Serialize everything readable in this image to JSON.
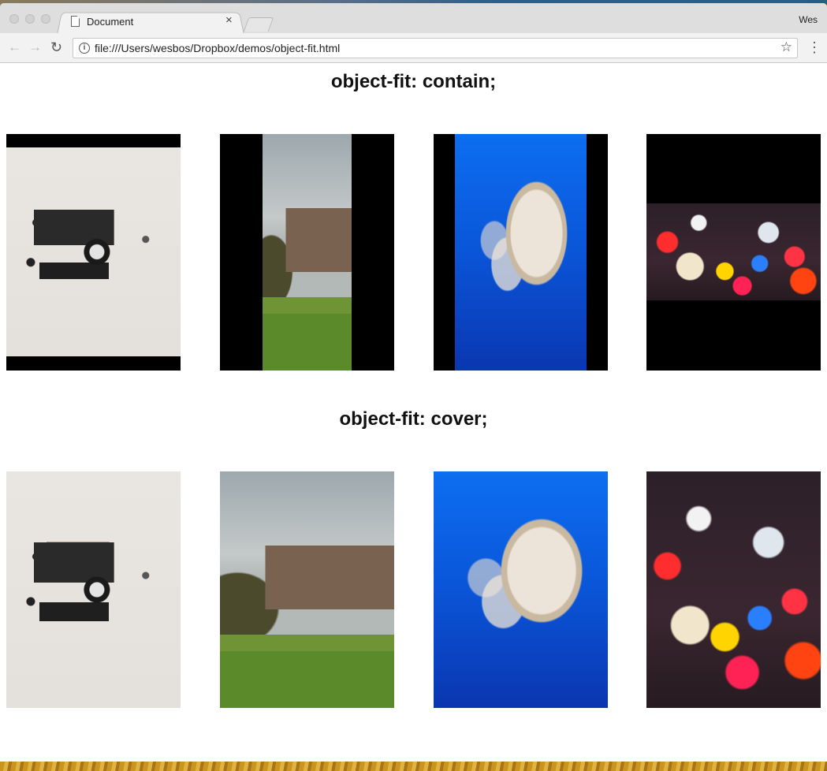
{
  "browser": {
    "tab_title": "Document",
    "tab_close": "×",
    "profile_name": "Wes",
    "url": "file:///Users/wesbos/Dropbox/demos/object-fit.html",
    "icons": {
      "back": "←",
      "forward": "→",
      "reload": "↻",
      "info": "i",
      "star": "☆",
      "menu": "⋮"
    }
  },
  "page": {
    "heading_contain": "object-fit: contain;",
    "heading_cover": "object-fit: cover;",
    "images": [
      "camera-flatlay",
      "castle-ruins",
      "jellyfish",
      "bokeh-lights"
    ]
  }
}
